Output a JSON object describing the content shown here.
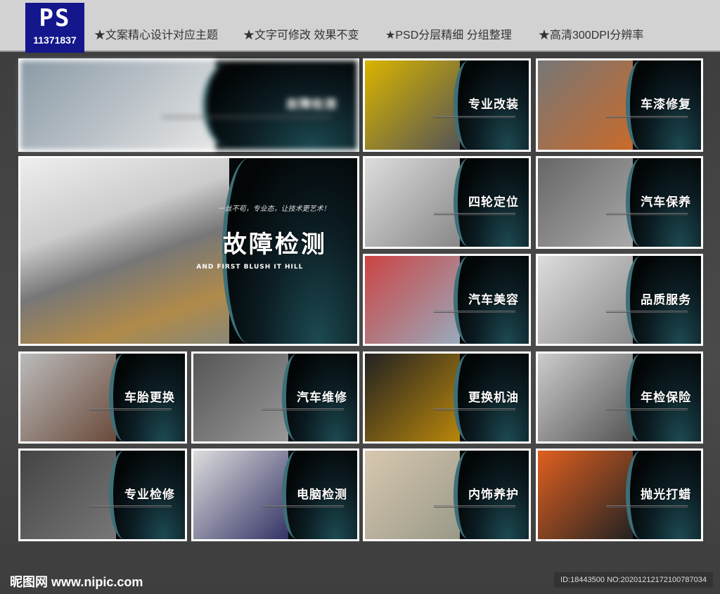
{
  "header": {
    "logo_text": "PS",
    "logo_id": "11371837",
    "features": [
      "★文案精心设计对应主题",
      "★文字可修改 效果不变",
      "★PSD分层精细 分组整理",
      "★高清300DPI分辨率"
    ]
  },
  "big": {
    "title": "故障检测",
    "tagline": "一丝不苟，专业态，让技术更艺术！",
    "english": "AND FIRST BLUSH IT HILL"
  },
  "cards": [
    "故障检测",
    "专业改装",
    "车漆修复",
    "四轮定位",
    "汽车保养",
    "汽车美容",
    "品质服务",
    "车胎更换",
    "汽车维修",
    "更换机油",
    "年检保险",
    "专业检修",
    "电脑检测",
    "内饰养护",
    "抛光打蜡"
  ],
  "footer": {
    "site": "昵图网 www.nipic.com",
    "id": "ID:18443500 NO:20201212172100787034"
  }
}
